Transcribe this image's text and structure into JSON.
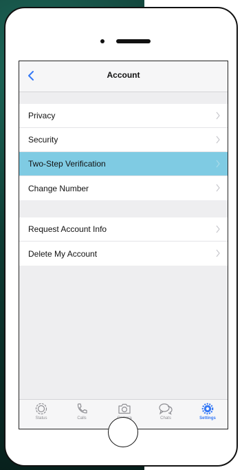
{
  "nav": {
    "title": "Account"
  },
  "settings_groups": [
    {
      "items": [
        {
          "label": "Privacy",
          "selected": false
        },
        {
          "label": "Security",
          "selected": false
        },
        {
          "label": "Two-Step Verification",
          "selected": true
        },
        {
          "label": "Change Number",
          "selected": false
        }
      ]
    },
    {
      "items": [
        {
          "label": "Request Account Info",
          "selected": false
        },
        {
          "label": "Delete My Account",
          "selected": false
        }
      ]
    }
  ],
  "tabbar": {
    "items": [
      {
        "label": "Status",
        "icon": "status-icon",
        "active": false
      },
      {
        "label": "Calls",
        "icon": "phone-icon",
        "active": false
      },
      {
        "label": "Camera",
        "icon": "camera-icon",
        "active": false
      },
      {
        "label": "Chats",
        "icon": "chat-bubbles-icon",
        "active": false
      },
      {
        "label": "Settings",
        "icon": "gear-icon",
        "active": true
      }
    ]
  },
  "colors": {
    "accent": "#3478f6",
    "selected_row": "#7fcbe3",
    "group_background": "#eeeef0"
  }
}
